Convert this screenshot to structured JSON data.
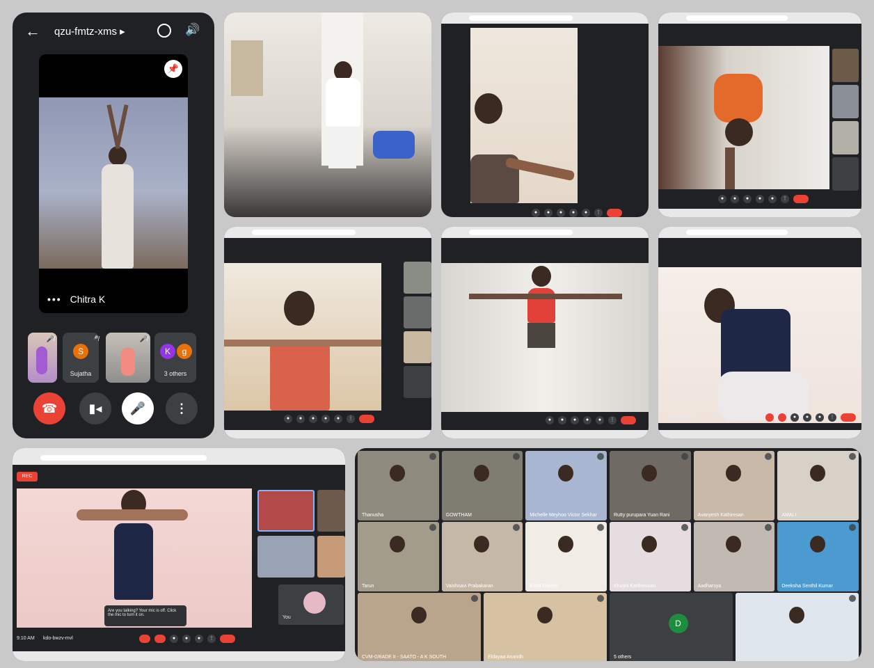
{
  "mobile": {
    "meeting_code": "qzu-fmtz-xms",
    "icons": {
      "back": "arrow-left-icon",
      "switch_camera": "camera-flip-icon",
      "audio": "speaker-icon",
      "pin": "pin-icon"
    },
    "featured_name": "Chitra K",
    "more_dots": "•••",
    "participants": [
      {
        "kind": "video",
        "muted": true
      },
      {
        "kind": "avatar",
        "initial": "S",
        "name": "Sujatha",
        "color": "#e8710a",
        "muted": true
      },
      {
        "kind": "video",
        "muted": true
      },
      {
        "kind": "group",
        "initials": [
          "K",
          "g"
        ],
        "colors": [
          "#9334e6",
          "#e8710a"
        ],
        "name": "3 others"
      }
    ],
    "controls": {
      "end_call": "end-call-icon",
      "camera": "video-camera-icon",
      "mic": "mic-off-icon",
      "more": "more-vert-icon"
    }
  },
  "tiles": {
    "meet_code_desktop": "kdo-bwzv-mvl",
    "time": "9:10 AM",
    "rec_badge": "REC",
    "toast": "Are you talking? Your mic is off. Click the mic to turn it on.",
    "you_label": "You"
  },
  "gallery": {
    "tiles": [
      {
        "name": "Thanusha"
      },
      {
        "name": "GOWTHAM"
      },
      {
        "name": "Michelle Meyhoo Victor Sekhar"
      },
      {
        "name": "Rutty purupara Yuan Rani"
      },
      {
        "name": "Avanyesh Kathiresan"
      },
      {
        "name": "AMALI"
      },
      {
        "name": "Tarun"
      },
      {
        "name": "Vaishnavi Prabakaran"
      },
      {
        "name": "Kirthi Rajesh"
      },
      {
        "name": "Khushi Kartheswari"
      },
      {
        "name": "Aadharsya"
      },
      {
        "name": "Deeksha Senthil Kumar"
      },
      {
        "name": "CVM-GRADE II - SAATO - A K SOUTH"
      },
      {
        "name": "Eldayaa Anandh"
      },
      {
        "name": "5 others",
        "initial": "D"
      },
      {
        "name": ""
      }
    ]
  }
}
